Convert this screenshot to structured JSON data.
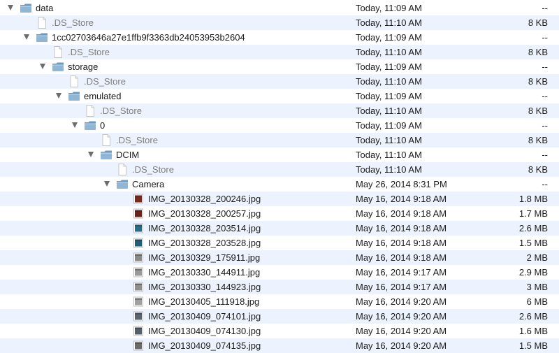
{
  "rows": [
    {
      "id": "data",
      "name": "data",
      "date": "Today, 11:09 AM",
      "size": "--",
      "type": "folder",
      "level": 0,
      "open": true
    },
    {
      "id": "ds1",
      "name": ".DS_Store",
      "date": "Today, 11:10 AM",
      "size": "8 KB",
      "type": "doc",
      "level": 1
    },
    {
      "id": "hash",
      "name": "1cc02703646a27e1ffb9f3363db24053953b2604",
      "date": "Today, 11:09 AM",
      "size": "--",
      "type": "folder",
      "level": 1,
      "open": true
    },
    {
      "id": "ds2",
      "name": ".DS_Store",
      "date": "Today, 11:10 AM",
      "size": "8 KB",
      "type": "doc",
      "level": 2
    },
    {
      "id": "storage",
      "name": "storage",
      "date": "Today, 11:09 AM",
      "size": "--",
      "type": "folder",
      "level": 2,
      "open": true
    },
    {
      "id": "ds3",
      "name": ".DS_Store",
      "date": "Today, 11:10 AM",
      "size": "8 KB",
      "type": "doc",
      "level": 3
    },
    {
      "id": "emulated",
      "name": "emulated",
      "date": "Today, 11:09 AM",
      "size": "--",
      "type": "folder",
      "level": 3,
      "open": true
    },
    {
      "id": "ds4",
      "name": ".DS_Store",
      "date": "Today, 11:10 AM",
      "size": "8 KB",
      "type": "doc",
      "level": 4
    },
    {
      "id": "zero",
      "name": "0",
      "date": "Today, 11:09 AM",
      "size": "--",
      "type": "folder",
      "level": 4,
      "open": true
    },
    {
      "id": "ds5",
      "name": ".DS_Store",
      "date": "Today, 11:10 AM",
      "size": "8 KB",
      "type": "doc",
      "level": 5
    },
    {
      "id": "dcim",
      "name": "DCIM",
      "date": "Today, 11:10 AM",
      "size": "--",
      "type": "folder",
      "level": 5,
      "open": true
    },
    {
      "id": "ds6",
      "name": ".DS_Store",
      "date": "Today, 11:10 AM",
      "size": "8 KB",
      "type": "doc",
      "level": 6
    },
    {
      "id": "camera",
      "name": "Camera",
      "date": "May 26, 2014 8:31 PM",
      "size": "--",
      "type": "folder",
      "level": 6,
      "open": true
    },
    {
      "id": "img1",
      "name": "IMG_20130328_200246.jpg",
      "date": "May 16, 2014 9:18 AM",
      "size": "1.8 MB",
      "type": "img",
      "level": 7,
      "thumb": "#7a2a1c"
    },
    {
      "id": "img2",
      "name": "IMG_20130328_200257.jpg",
      "date": "May 16, 2014 9:18 AM",
      "size": "1.7 MB",
      "type": "img",
      "level": 7,
      "thumb": "#6e2418"
    },
    {
      "id": "img3",
      "name": "IMG_20130328_203514.jpg",
      "date": "May 16, 2014 9:18 AM",
      "size": "2.6 MB",
      "type": "img",
      "level": 7,
      "thumb": "#2a6d87"
    },
    {
      "id": "img4",
      "name": "IMG_20130328_203528.jpg",
      "date": "May 16, 2014 9:18 AM",
      "size": "1.5 MB",
      "type": "img",
      "level": 7,
      "thumb": "#1f5f78"
    },
    {
      "id": "img5",
      "name": "IMG_20130329_175911.jpg",
      "date": "May 16, 2014 9:18 AM",
      "size": "2 MB",
      "type": "img",
      "level": 7,
      "thumb": "#8a8a8a"
    },
    {
      "id": "img6",
      "name": "IMG_20130330_144911.jpg",
      "date": "May 16, 2014 9:17 AM",
      "size": "2.9 MB",
      "type": "img",
      "level": 7,
      "thumb": "#9a9a9a"
    },
    {
      "id": "img7",
      "name": "IMG_20130330_144923.jpg",
      "date": "May 16, 2014 9:17 AM",
      "size": "3 MB",
      "type": "img",
      "level": 7,
      "thumb": "#8f8f8f"
    },
    {
      "id": "img8",
      "name": "IMG_20130405_111918.jpg",
      "date": "May 16, 2014 9:20 AM",
      "size": "6 MB",
      "type": "img",
      "level": 7,
      "thumb": "#a0a0a0"
    },
    {
      "id": "img9",
      "name": "IMG_20130409_074101.jpg",
      "date": "May 16, 2014 9:20 AM",
      "size": "2.6 MB",
      "type": "img",
      "level": 7,
      "thumb": "#5a6570"
    },
    {
      "id": "img10",
      "name": "IMG_20130409_074130.jpg",
      "date": "May 16, 2014 9:20 AM",
      "size": "1.6 MB",
      "type": "img",
      "level": 7,
      "thumb": "#55606a"
    },
    {
      "id": "img11",
      "name": "IMG_20130409_074135.jpg",
      "date": "May 16, 2014 9:20 AM",
      "size": "1.5 MB",
      "type": "img",
      "level": 7,
      "thumb": "#6a6a6a"
    }
  ],
  "colors": {
    "folder_front": "#8fb6d4",
    "folder_back": "#6f9ac0",
    "row_alt": "#edf3fe",
    "triangle": "#6d6d6d"
  }
}
